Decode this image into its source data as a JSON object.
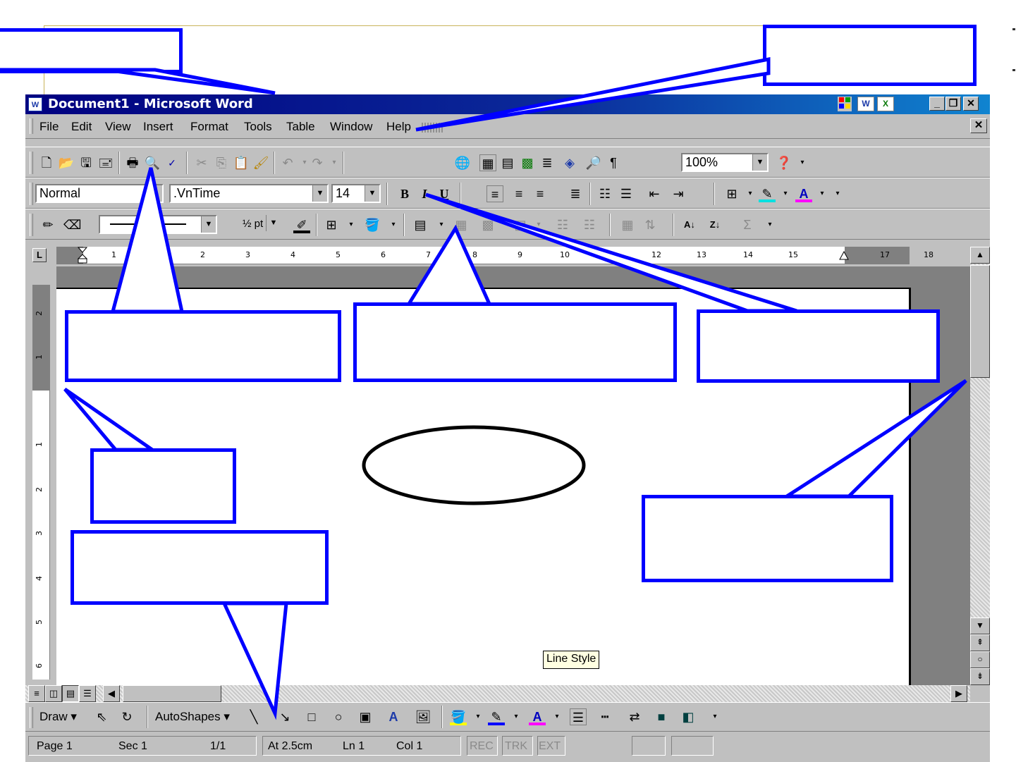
{
  "window": {
    "title": "Document1 - Microsoft Word",
    "doc_icon": "W",
    "app_icons": [
      "W",
      "X"
    ]
  },
  "menu": [
    "File",
    "Edit",
    "View",
    "Insert",
    "Format",
    "Tools",
    "Table",
    "Window",
    "Help"
  ],
  "standard_toolbar": {
    "zoom": "100%"
  },
  "formatting_toolbar": {
    "style": "Normal",
    "font": ".VnTime",
    "size": "14",
    "bold": "B",
    "italic": "I",
    "underline": "U"
  },
  "tables_toolbar": {
    "line_weight": "½ pt"
  },
  "ruler": {
    "h_numbers": [
      "1",
      "1",
      "2",
      "3",
      "4",
      "5",
      "6",
      "7",
      "8",
      "9",
      "10",
      "11",
      "12",
      "13",
      "14",
      "15",
      "17",
      "18"
    ],
    "v_numbers": [
      "2",
      "1",
      "1",
      "2",
      "3",
      "4",
      "5",
      "6"
    ]
  },
  "drawing_toolbar": {
    "draw": "Draw",
    "autoshapes": "AutoShapes"
  },
  "status": {
    "page": "Page 1",
    "sec": "Sec 1",
    "pages": "1/1",
    "at": "At 2.5cm",
    "ln": "Ln 1",
    "col": "Col 1",
    "rec": "REC",
    "trk": "TRK",
    "ext": "EXT",
    "tooltip": "Line Style"
  },
  "colors": {
    "callout": "#0000ff",
    "titlebar_start": "#000080",
    "titlebar_end": "#1084d0"
  }
}
